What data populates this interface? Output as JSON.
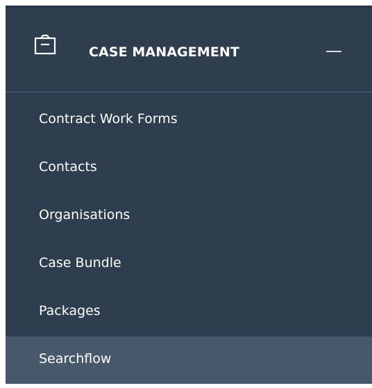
{
  "section": {
    "title": "CASE MANAGEMENT",
    "icon": "clipboard-icon",
    "collapse_icon": "minus-icon"
  },
  "items": [
    {
      "label": "Contract Work Forms"
    },
    {
      "label": "Contacts"
    },
    {
      "label": "Organisations"
    },
    {
      "label": "Case Bundle"
    },
    {
      "label": "Packages"
    },
    {
      "label": "Searchflow"
    }
  ],
  "active_item": "Searchflow",
  "colors": {
    "background": "#2e3e4f",
    "active_background": "#48596b",
    "divider": "#52677d",
    "text": "#ffffff"
  }
}
